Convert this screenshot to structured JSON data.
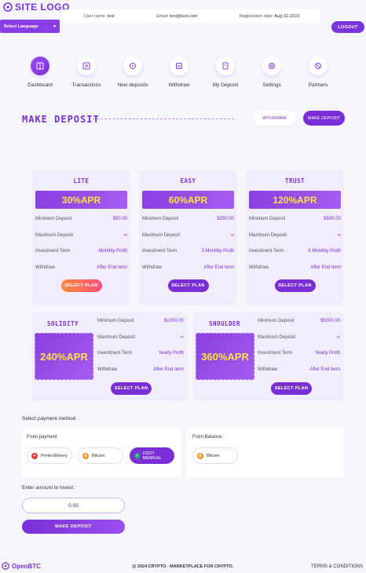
{
  "header": {
    "logo": "SITE LOGO",
    "username_label": "User name:",
    "username": "test",
    "email_label": "Email:",
    "email": "test@test.com",
    "regdate_label": "Registration date:",
    "regdate": "Aug-31-2023",
    "language": "Select Language",
    "logout": "LOGOUT"
  },
  "nav": [
    {
      "label": "Dashboard",
      "icon": "dashboard-icon"
    },
    {
      "label": "Transactions",
      "icon": "transactions-icon"
    },
    {
      "label": "New deposits",
      "icon": "new-deposit-icon"
    },
    {
      "label": "Withdraw",
      "icon": "withdraw-icon"
    },
    {
      "label": "My Deposit",
      "icon": "my-deposit-icon"
    },
    {
      "label": "Settings",
      "icon": "settings-icon"
    },
    {
      "label": "Partners",
      "icon": "partners-icon"
    }
  ],
  "section": {
    "title": "MAKE DEPOSIT",
    "withdraw_btn": "WITHDRAW",
    "make_deposit_btn": "MAKE DEPOSIT"
  },
  "labels": {
    "min": "Minimum Deposit",
    "max": "Maximum Deposit",
    "term": "Investment Term",
    "withdraw": "Withdraw",
    "select": "SELECT PLAN"
  },
  "plans": [
    {
      "name": "LITE",
      "apr": "30%APR",
      "min": "$50.00",
      "max": "∞",
      "term": "Monthly Profit",
      "withdraw": "After End term"
    },
    {
      "name": "EASY",
      "apr": "60%APR",
      "min": "$250.00",
      "max": "∞",
      "term": "3 Monthly Profit",
      "withdraw": "After End term"
    },
    {
      "name": "TRUST",
      "apr": "120%APR",
      "min": "$500.00",
      "max": "∞",
      "term": "6 Monthly Profit",
      "withdraw": "After End term"
    },
    {
      "name": "SOLIDITY",
      "apr": "240%APR",
      "min": "$1000.00",
      "max": "∞",
      "term": "Yearly Profit",
      "withdraw": "After End term"
    },
    {
      "name": "SHOULDER",
      "apr": "360%APR",
      "min": "$5000.00",
      "max": "∞",
      "term": "Yearly Profit",
      "withdraw": "After End term"
    }
  ],
  "payment": {
    "title": "Select payment method :",
    "from_payment": "From payment",
    "from_balance": "From Balance",
    "methods": [
      "PerfectMoney",
      "Bitcoin",
      "USDT MEMGAL"
    ],
    "balance_methods": [
      "Bitcoin"
    ],
    "colors": {
      "perfectmoney": "#e03a2f",
      "bitcoin": "#f7931a",
      "usdt": "#26a17b"
    }
  },
  "amount": {
    "label": "Enter amount to invest :",
    "value": "0.00",
    "submit": "MAKE DEPOSIT"
  },
  "footer": {
    "logo": "OpenBTC",
    "copyright": "@ 2024 CRYPTO - MARKETPLACE FOR CRYPTO.",
    "terms": "TERMS & CONDITIONS"
  }
}
